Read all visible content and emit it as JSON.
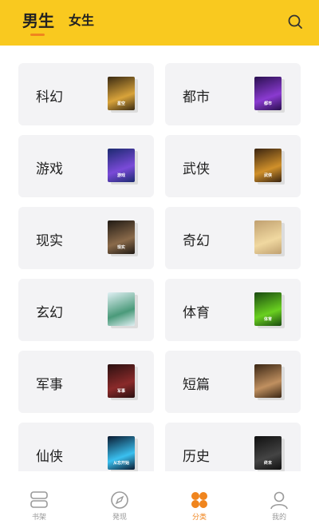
{
  "header": {
    "tabs": [
      {
        "label": "男生",
        "active": true
      },
      {
        "label": "女生",
        "active": false
      }
    ],
    "search_icon": "search-icon",
    "background": "#f9c91f",
    "accent": "#f0851e"
  },
  "categories": [
    {
      "label": "科幻",
      "cover": {
        "colors": [
          "#3a2a12",
          "#d8a33a"
        ],
        "title": "星空"
      }
    },
    {
      "label": "都市",
      "cover": {
        "colors": [
          "#2a1050",
          "#8a3ad0"
        ],
        "title": "都市"
      }
    },
    {
      "label": "游戏",
      "cover": {
        "colors": [
          "#1c2a70",
          "#7a4ad8"
        ],
        "title": "游戏"
      }
    },
    {
      "label": "武侠",
      "cover": {
        "colors": [
          "#3a2410",
          "#d0902a"
        ],
        "title": "武侠"
      }
    },
    {
      "label": "现实",
      "cover": {
        "colors": [
          "#201a14",
          "#8a6a4a"
        ],
        "title": "现实"
      }
    },
    {
      "label": "奇幻",
      "cover": {
        "colors": [
          "#c0a070",
          "#f0d8a0"
        ],
        "title": ""
      }
    },
    {
      "label": "玄幻",
      "cover": {
        "colors": [
          "#e0f0f4",
          "#4a9a7a"
        ],
        "title": ""
      }
    },
    {
      "label": "体育",
      "cover": {
        "colors": [
          "#1a4a10",
          "#6ad020"
        ],
        "title": "体育"
      }
    },
    {
      "label": "军事",
      "cover": {
        "colors": [
          "#2a1010",
          "#8a2a2a"
        ],
        "title": "军事"
      }
    },
    {
      "label": "短篇",
      "cover": {
        "colors": [
          "#3a2614",
          "#c09060"
        ],
        "title": ""
      }
    },
    {
      "label": "仙侠",
      "cover": {
        "colors": [
          "#0a1a30",
          "#3ac0f0"
        ],
        "title": "从忘开始"
      }
    },
    {
      "label": "历史",
      "cover": {
        "colors": [
          "#101010",
          "#444444"
        ],
        "title": "终末"
      }
    }
  ],
  "bottom_nav": [
    {
      "label": "书架",
      "icon": "bookshelf-icon",
      "active": false
    },
    {
      "label": "発现",
      "icon": "compass-icon",
      "active": false
    },
    {
      "label": "分类",
      "icon": "category-clover-icon",
      "active": true
    },
    {
      "label": "我的",
      "icon": "profile-icon",
      "active": false
    }
  ]
}
